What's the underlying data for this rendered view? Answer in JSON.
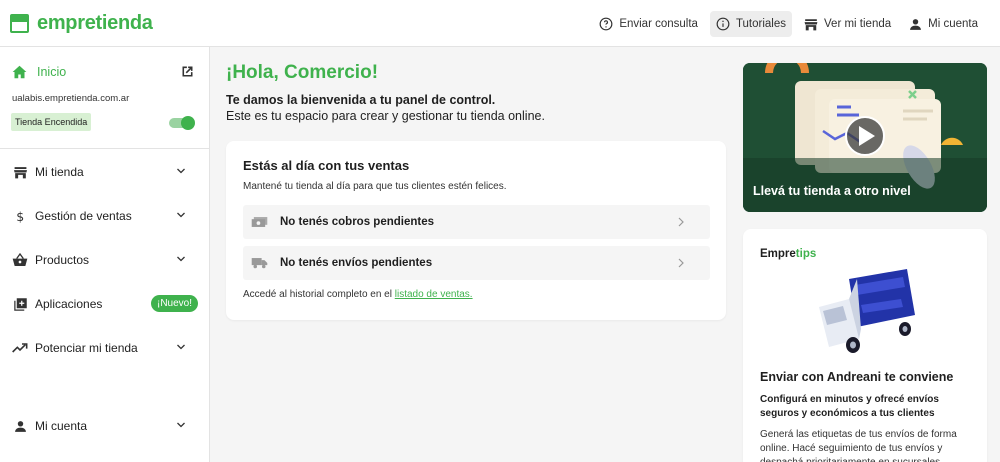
{
  "brand": {
    "name": "empretienda",
    "color": "#3fb24d"
  },
  "topbar": {
    "actions": [
      {
        "label": "Enviar consulta",
        "icon": "help-circle-icon"
      },
      {
        "label": "Tutoriales",
        "icon": "info-icon",
        "active": true
      },
      {
        "label": "Ver mi tienda",
        "icon": "store-icon"
      },
      {
        "label": "Mi cuenta",
        "icon": "person-icon"
      }
    ]
  },
  "sidebar": {
    "home_label": "Inicio",
    "store_url": "ualabis.empretienda.com.ar",
    "store_status": "Tienda Encendida",
    "store_on": true,
    "items": [
      {
        "label": "Mi tienda",
        "icon": "storefront-icon"
      },
      {
        "label": "Gestión de ventas",
        "icon": "dollar-icon"
      },
      {
        "label": "Productos",
        "icon": "basket-icon"
      },
      {
        "label": "Aplicaciones",
        "icon": "add-box-icon",
        "badge": "¡Nuevo!"
      },
      {
        "label": "Potenciar mi tienda",
        "icon": "trending-up-icon"
      }
    ],
    "account_label": "Mi cuenta"
  },
  "main": {
    "greeting": "¡Hola, Comercio!",
    "welcome": "Te damos la bienvenida a tu panel de control.",
    "subwelcome": "Este es tu espacio para crear y gestionar tu tienda online."
  },
  "sales": {
    "title": "Estás al día con tus ventas",
    "subtitle": "Mantené tu tienda al día para que tus clientes estén felices.",
    "pending_payments": "No tenés cobros pendientes",
    "pending_shipments": "No tenés envíos pendientes",
    "history_text": "Accedé al historial completo en el ",
    "history_link": "listado de ventas."
  },
  "video": {
    "caption": "Llevá tu tienda a otro nivel"
  },
  "tips": {
    "title_a": "Empre",
    "title_b": "tips",
    "headline": "Enviar con Andreani te conviene",
    "lead": "Configurá en minutos y ofrecé envíos seguros y económicos a tus clientes",
    "body": "Generá las etiquetas de tus envíos de forma online. Hacé seguimiento de tus envíos y despachá prioritariamente en sucursales"
  }
}
